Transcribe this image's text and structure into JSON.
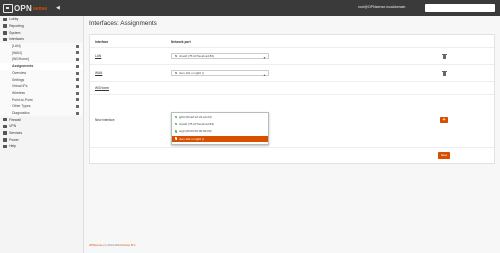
{
  "app": {
    "logo_main": "OPN",
    "logo_sub": "sense",
    "user": "root@OPNsense.localdomain",
    "search_placeholder": ""
  },
  "sidebar": {
    "items": [
      {
        "label": "Lobby",
        "icon": "dashboard-icon",
        "level": "top"
      },
      {
        "label": "Reporting",
        "icon": "chart-icon",
        "level": "top"
      },
      {
        "label": "System",
        "icon": "gear-icon",
        "level": "top"
      },
      {
        "label": "Interfaces",
        "icon": "sitemap-icon",
        "level": "top"
      },
      {
        "label": "[LAN]",
        "icon": "download-icon",
        "level": "sub"
      },
      {
        "label": "[WAN]",
        "icon": "download-icon",
        "level": "sub"
      },
      {
        "label": "[WGHome]",
        "icon": "download-icon",
        "level": "sub"
      },
      {
        "label": "Assignments",
        "icon": "pencil-icon",
        "level": "sub",
        "active": true
      },
      {
        "label": "Overview",
        "icon": "tasks-icon",
        "level": "sub"
      },
      {
        "label": "Settings",
        "icon": "cogs-icon",
        "level": "sub"
      },
      {
        "label": "Virtual IPs",
        "icon": "clone-icon",
        "level": "sub"
      },
      {
        "label": "Wireless",
        "icon": "wifi-icon",
        "level": "sub"
      },
      {
        "label": "Point-to-Point",
        "icon": "tty-icon",
        "level": "sub"
      },
      {
        "label": "Other Types",
        "icon": "list-icon",
        "level": "sub"
      },
      {
        "label": "Diagnostics",
        "icon": "medkit-icon",
        "level": "sub"
      },
      {
        "label": "Firewall",
        "icon": "fire-icon",
        "level": "top"
      },
      {
        "label": "VPN",
        "icon": "lock-icon",
        "level": "top"
      },
      {
        "label": "Services",
        "icon": "cog-icon",
        "level": "top"
      },
      {
        "label": "Power",
        "icon": "plug-icon",
        "level": "top"
      },
      {
        "label": "Help",
        "icon": "support-icon",
        "level": "top"
      }
    ]
  },
  "page": {
    "title": "Interfaces: Assignments",
    "col_interface": "Interface",
    "col_network_port": "Network port"
  },
  "rows": {
    "lan": {
      "label": "LAN",
      "port": "vtnet0 (75:c0:5a:ab:a4:83)"
    },
    "wan": {
      "label": "WAN",
      "port": "vlan 101 on igb0 ()"
    },
    "wghome": {
      "label": "WGHome"
    },
    "new": {
      "label": "New interface",
      "description_placeholder": "Description"
    }
  },
  "dropdown": {
    "options": [
      {
        "label": "igb0 (00:a0:a7:22:a4:24)",
        "selected": false
      },
      {
        "label": "vtnet0 (75:c0:5a:ab:a4:83)",
        "selected": false
      },
      {
        "label": "wg0 (00:00:00:00:00:00)",
        "selected": false
      },
      {
        "label": "vlan 101 on igb0 ()",
        "selected": true
      }
    ]
  },
  "buttons": {
    "add": "+",
    "save": "Save"
  },
  "footer": {
    "brand": "OPNsense",
    "text": " (c) 2014-2024 ",
    "company": "Deciso B.V."
  },
  "colors": {
    "accent": "#d94f00",
    "topbar": "#3a3a3a"
  }
}
